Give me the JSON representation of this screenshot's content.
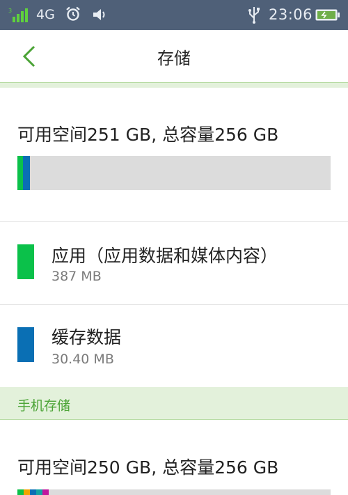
{
  "status_bar": {
    "network": "4G",
    "time": "23:06",
    "icons": [
      "signal-icon",
      "alarm-icon",
      "volume-icon",
      "usb-icon",
      "battery-icon"
    ]
  },
  "app_bar": {
    "title": "存储"
  },
  "internal": {
    "summary": "可用空间251 GB, 总容量256 GB",
    "usage_fraction": [
      0.018,
      0.022
    ]
  },
  "categories": [
    {
      "label": "应用（应用数据和媒体内容）",
      "size": "387 MB",
      "color": "#0bc14a"
    },
    {
      "label": "缓存数据",
      "size": "30.40 MB",
      "color": "#0a6fb4"
    }
  ],
  "phone_storage": {
    "header": "手机存储",
    "summary": "可用空间250 GB, 总容量256 GB",
    "segment_colors": [
      "#0bc14a",
      "#f0a400",
      "#0a6fb4",
      "#12a3a3",
      "#c0169e"
    ]
  },
  "colors": {
    "status_bar_bg": "#4f6078",
    "accent_green": "#4aa335",
    "section_bg": "#e3f1db",
    "bar_track": "#dcdcdc"
  }
}
